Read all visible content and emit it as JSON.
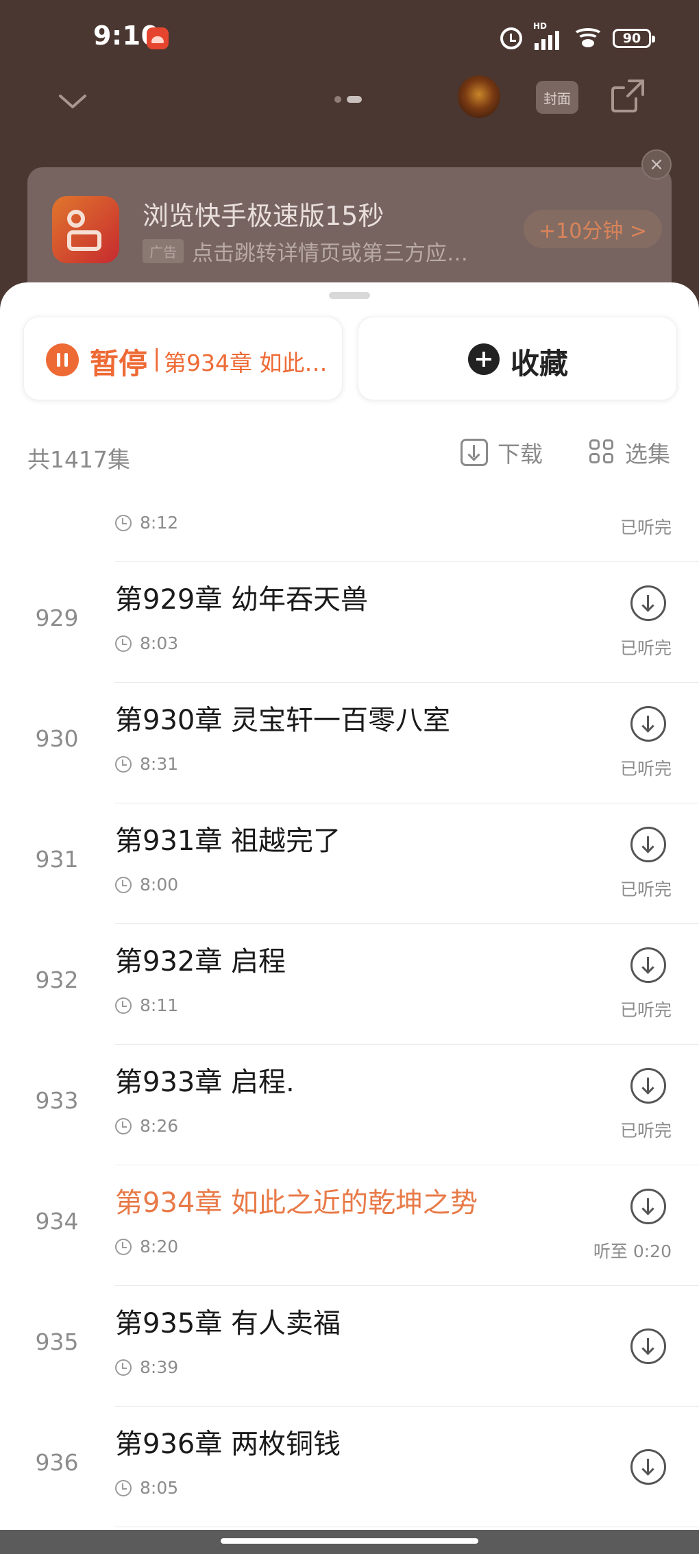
{
  "status_bar": {
    "time": "9:10",
    "network_label": "HD",
    "battery": "90"
  },
  "player": {
    "cover_label": "封面"
  },
  "ad": {
    "title": "浏览快手极速版15秒",
    "tag": "广告",
    "subtitle": "点击跳转详情页或第三方应…",
    "reward": "+10分钟 >",
    "close": "×"
  },
  "actions": {
    "pause_label": "暂停",
    "separator": "|",
    "current_chapter": "第934章 如此之近的乾坤之势",
    "favorite_label": "收藏"
  },
  "list_header": {
    "total": "共1417集",
    "download_label": "下载",
    "select_label": "选集"
  },
  "episodes": [
    {
      "num": "",
      "title": "",
      "duration": "8:12",
      "status": "已听完"
    },
    {
      "num": "929",
      "title": "第929章 幼年吞天兽",
      "duration": "8:03",
      "status": "已听完"
    },
    {
      "num": "930",
      "title": "第930章 灵宝轩一百零八室",
      "duration": "8:31",
      "status": "已听完"
    },
    {
      "num": "931",
      "title": "第931章 祖越完了",
      "duration": "8:00",
      "status": "已听完"
    },
    {
      "num": "932",
      "title": "第932章 启程",
      "duration": "8:11",
      "status": "已听完"
    },
    {
      "num": "933",
      "title": "第933章 启程.",
      "duration": "8:26",
      "status": "已听完"
    },
    {
      "num": "934",
      "title": "第934章 如此之近的乾坤之势",
      "duration": "8:20",
      "status": "听至 0:20"
    },
    {
      "num": "935",
      "title": "第935章 有人卖福",
      "duration": "8:39",
      "status": ""
    },
    {
      "num": "936",
      "title": "第936章 两枚铜钱",
      "duration": "8:05",
      "status": ""
    }
  ],
  "colors": {
    "accent": "#ee6a35",
    "playing_title": "#e87a48",
    "muted": "#8c8c8c"
  }
}
